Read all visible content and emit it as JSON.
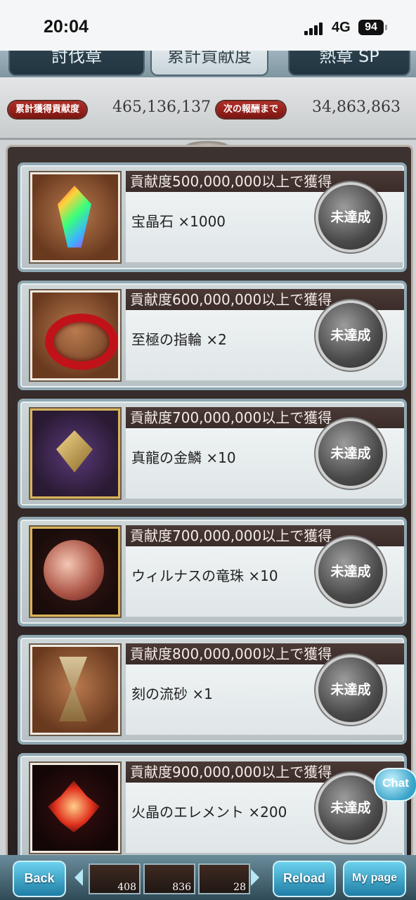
{
  "status": {
    "time": "20:04",
    "network": "4G",
    "battery": "94"
  },
  "tabs": [
    {
      "label": "討伐章"
    },
    {
      "label": "累計貢献度"
    },
    {
      "label": "熱章 SP"
    }
  ],
  "summary": {
    "total_label": "累計獲得貢献度",
    "total_value": "465,136,137",
    "next_label": "次の報酬まで",
    "next_value": "34,863,863"
  },
  "rewards": [
    {
      "header": "貢献度500,000,000以上で獲得",
      "item": "宝晶石 ×1000",
      "status": "未達成",
      "icon": "rainbow-crystal-icon"
    },
    {
      "header": "貢献度600,000,000以上で獲得",
      "item": "至極の指輪 ×2",
      "status": "未達成",
      "icon": "red-ring-icon"
    },
    {
      "header": "貢献度700,000,000以上で獲得",
      "item": "真龍の金鱗 ×10",
      "status": "未達成",
      "icon": "golden-scale-icon"
    },
    {
      "header": "貢献度700,000,000以上で獲得",
      "item": "ウィルナスの竜珠 ×10",
      "status": "未達成",
      "icon": "dragon-orb-icon"
    },
    {
      "header": "貢献度800,000,000以上で獲得",
      "item": "刻の流砂 ×1",
      "status": "未達成",
      "icon": "hourglass-icon"
    },
    {
      "header": "貢献度900,000,000以上で獲得",
      "item": "火晶のエレメント ×200",
      "status": "未達成",
      "icon": "fire-element-icon"
    }
  ],
  "chat": {
    "label": "Chat"
  },
  "bottom": {
    "back": "Back",
    "reload": "Reload",
    "mypage": "My page",
    "stock": [
      "408",
      "836",
      "28"
    ]
  }
}
